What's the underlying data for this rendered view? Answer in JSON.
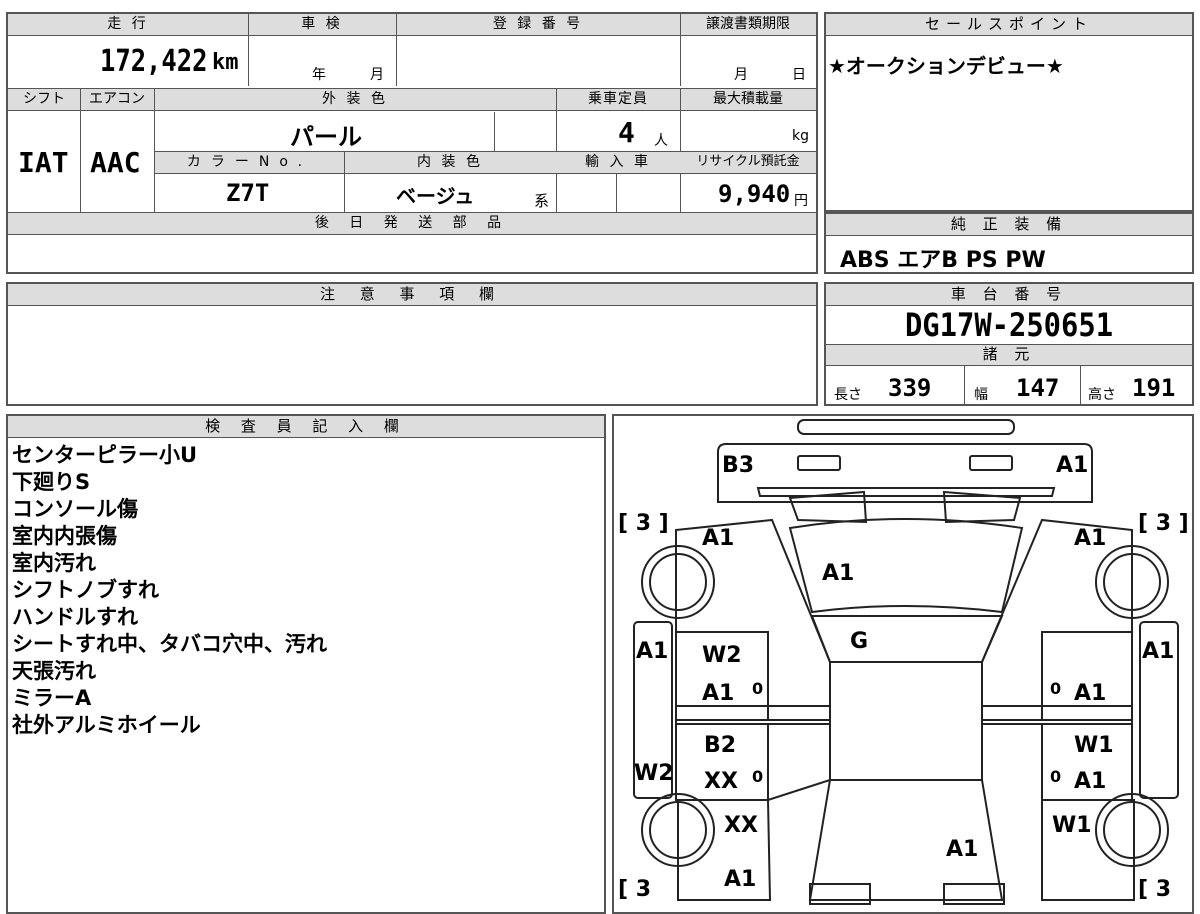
{
  "main_table": {
    "mileage_label": "走 行",
    "mileage_value": "172,422",
    "mileage_unit": "km",
    "inspection_label": "車 検",
    "inspection_year": "年",
    "inspection_month": "月",
    "registration_label": "登 録 番 号",
    "transfer_label": "譲渡書類期限",
    "transfer_month": "月",
    "transfer_day": "日",
    "shift_label": "シフト",
    "shift_value": "IAT",
    "aircon_label": "エアコン",
    "aircon_value": "AAC",
    "exterior_color_label": "外 装 色",
    "exterior_color_value": "パール",
    "capacity_label": "乗車定員",
    "capacity_value": "4",
    "capacity_unit": "人",
    "max_load_label": "最大積載量",
    "max_load_unit": "kg",
    "color_no_label": "カラーNo.",
    "color_no_value": "Z7T",
    "interior_color_label": "内 装 色",
    "interior_color_value": "ベージュ",
    "interior_color_suffix": "系",
    "import_label": "輸 入 車",
    "recycle_label": "リサイクル預託金",
    "recycle_value": "9,940",
    "recycle_unit": "円",
    "later_parts_label": "後 日 発 送 部 品"
  },
  "sales_point": {
    "label": "セールスポイント",
    "text": "★オークションデビュー★"
  },
  "equipment": {
    "label": "純 正 装 備",
    "text": "ABS エアB PS PW"
  },
  "notes": {
    "label": "注 意 事 項 欄"
  },
  "chassis": {
    "label": "車 台 番 号",
    "value": "DG17W-250651",
    "specs_label": "諸 元",
    "length_label": "長さ",
    "length_value": "339",
    "width_label": "幅",
    "width_value": "147",
    "height_label": "高さ",
    "height_value": "191"
  },
  "inspector": {
    "label": "検 査 員 記 入 欄",
    "lines": [
      "センターピラー小U",
      "下廻りS",
      "コンソール傷",
      "室内内張傷",
      "室内汚れ",
      "シフトノブすれ",
      "ハンドルすれ",
      "シートすれ中、タバコ穴中、汚れ",
      "天張汚れ",
      "ミラーA",
      "社外アルミホイール"
    ]
  },
  "diagram": {
    "marks": {
      "rear_left": "B3",
      "rear_right": "A1",
      "tire_rl": "[ 3 ]",
      "tire_rr": "[ 3 ]",
      "tire_fl": "[ 3",
      "tire_fr": "[ 3",
      "quarter_left": "A1",
      "quarter_right": "A1",
      "back_window": "A1",
      "roof": "G",
      "rear_pillar_left": "A1",
      "rear_pillar_right": "A1",
      "rear_door_left_top": "W2",
      "rear_door_left_bottom": "A1",
      "rear_door_right": "A1",
      "front_door_left_top": "B2",
      "front_door_left_bottom": "XX",
      "front_door_right_top": "W1",
      "front_door_right_bottom": "A1",
      "front_pillar_left": "W2",
      "fender_left": "XX",
      "fender_right": "W1",
      "hood": "A1",
      "front_left": "A1",
      "glass_mark": "0"
    }
  }
}
